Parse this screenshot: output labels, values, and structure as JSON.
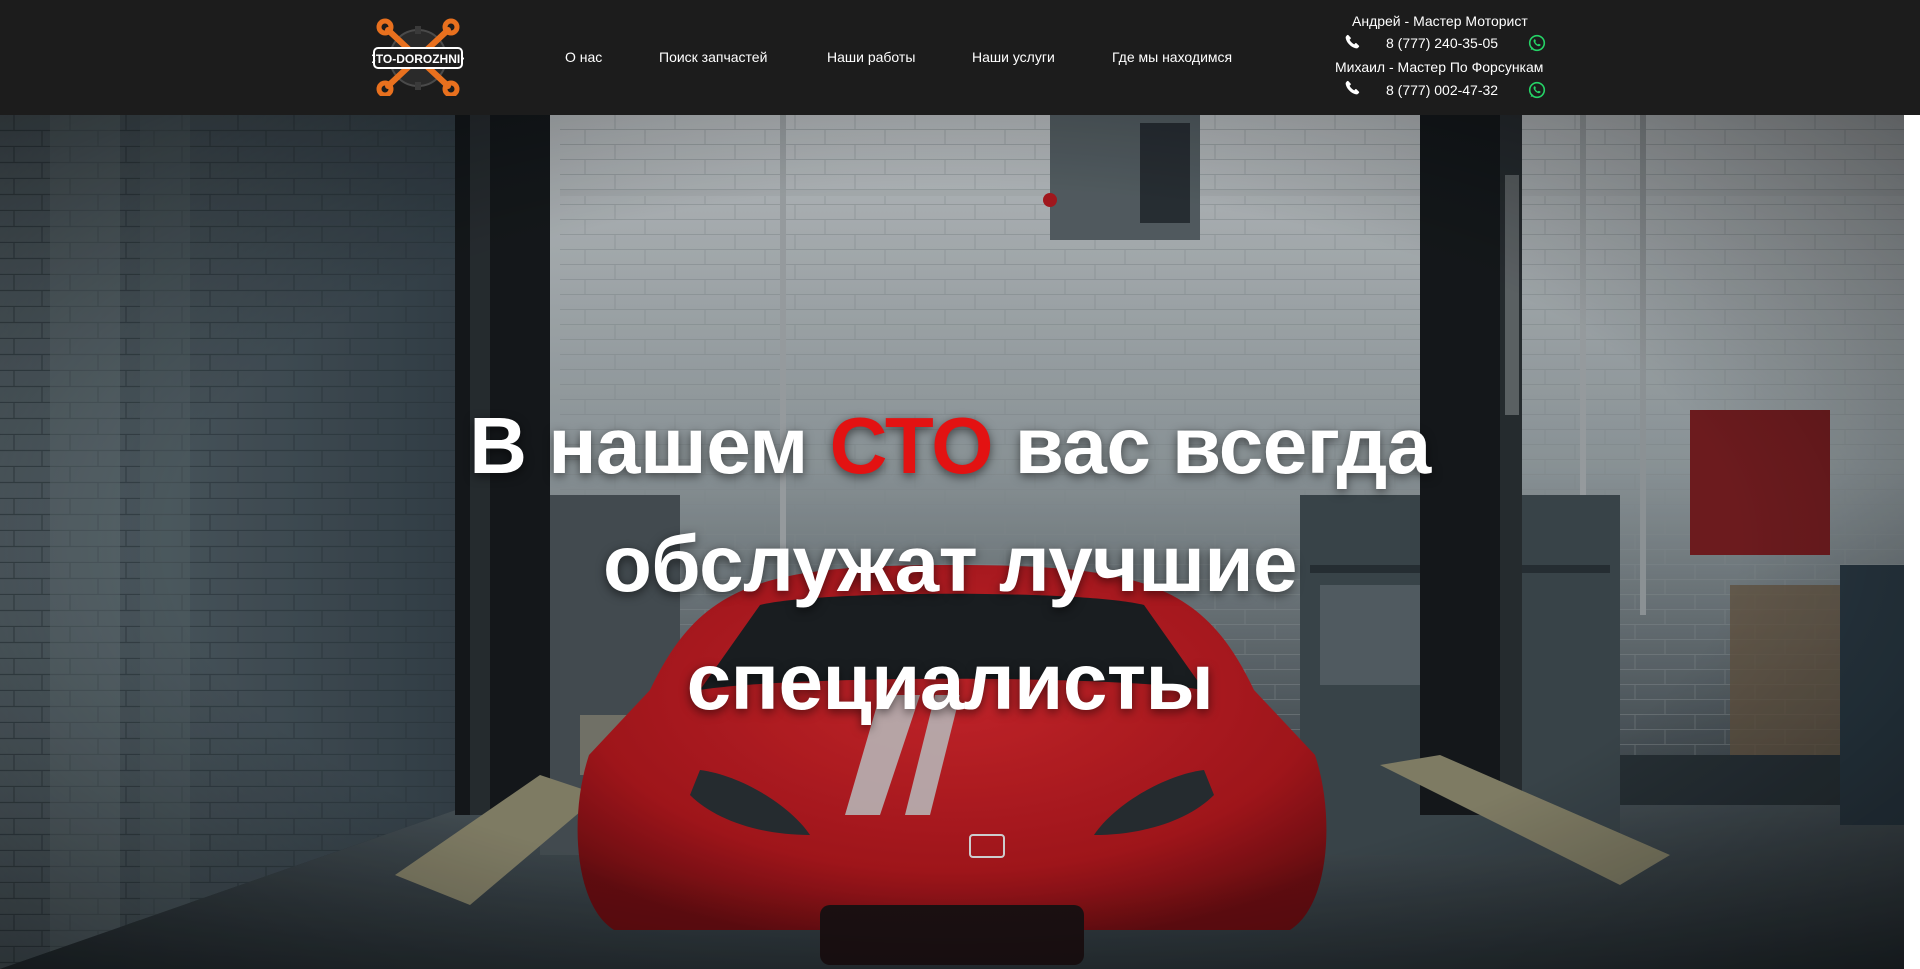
{
  "logo": {
    "text": "CTO-DOROZHNIK"
  },
  "nav": {
    "items": [
      {
        "label": "О нас"
      },
      {
        "label": "Поиск запчастей"
      },
      {
        "label": "Наши работы"
      },
      {
        "label": "Наши услуги"
      },
      {
        "label": "Где мы находимся"
      }
    ]
  },
  "contacts": [
    {
      "name": "Андрей - Мастер Моторист",
      "phone": "8 (777) 240-35-05",
      "icons": [
        "phone-icon",
        "whatsapp-icon"
      ]
    },
    {
      "name": "Михаил - Мастер По Форсункам",
      "phone": "8 (777) 002-47-32",
      "icons": [
        "phone-icon",
        "whatsapp-icon"
      ]
    }
  ],
  "hero": {
    "headline_before": "В нашем",
    "headline_accent": "СТО",
    "headline_line1_after": "вас всегда",
    "headline_line2": "обслужат лучшие",
    "headline_line3": "специалисты"
  },
  "colors": {
    "header_bg": "#1c1c1c",
    "accent_red": "#e31212",
    "logo_orange": "#e8701e",
    "whatsapp_green": "#25d366",
    "car_red": "#b8141a"
  }
}
